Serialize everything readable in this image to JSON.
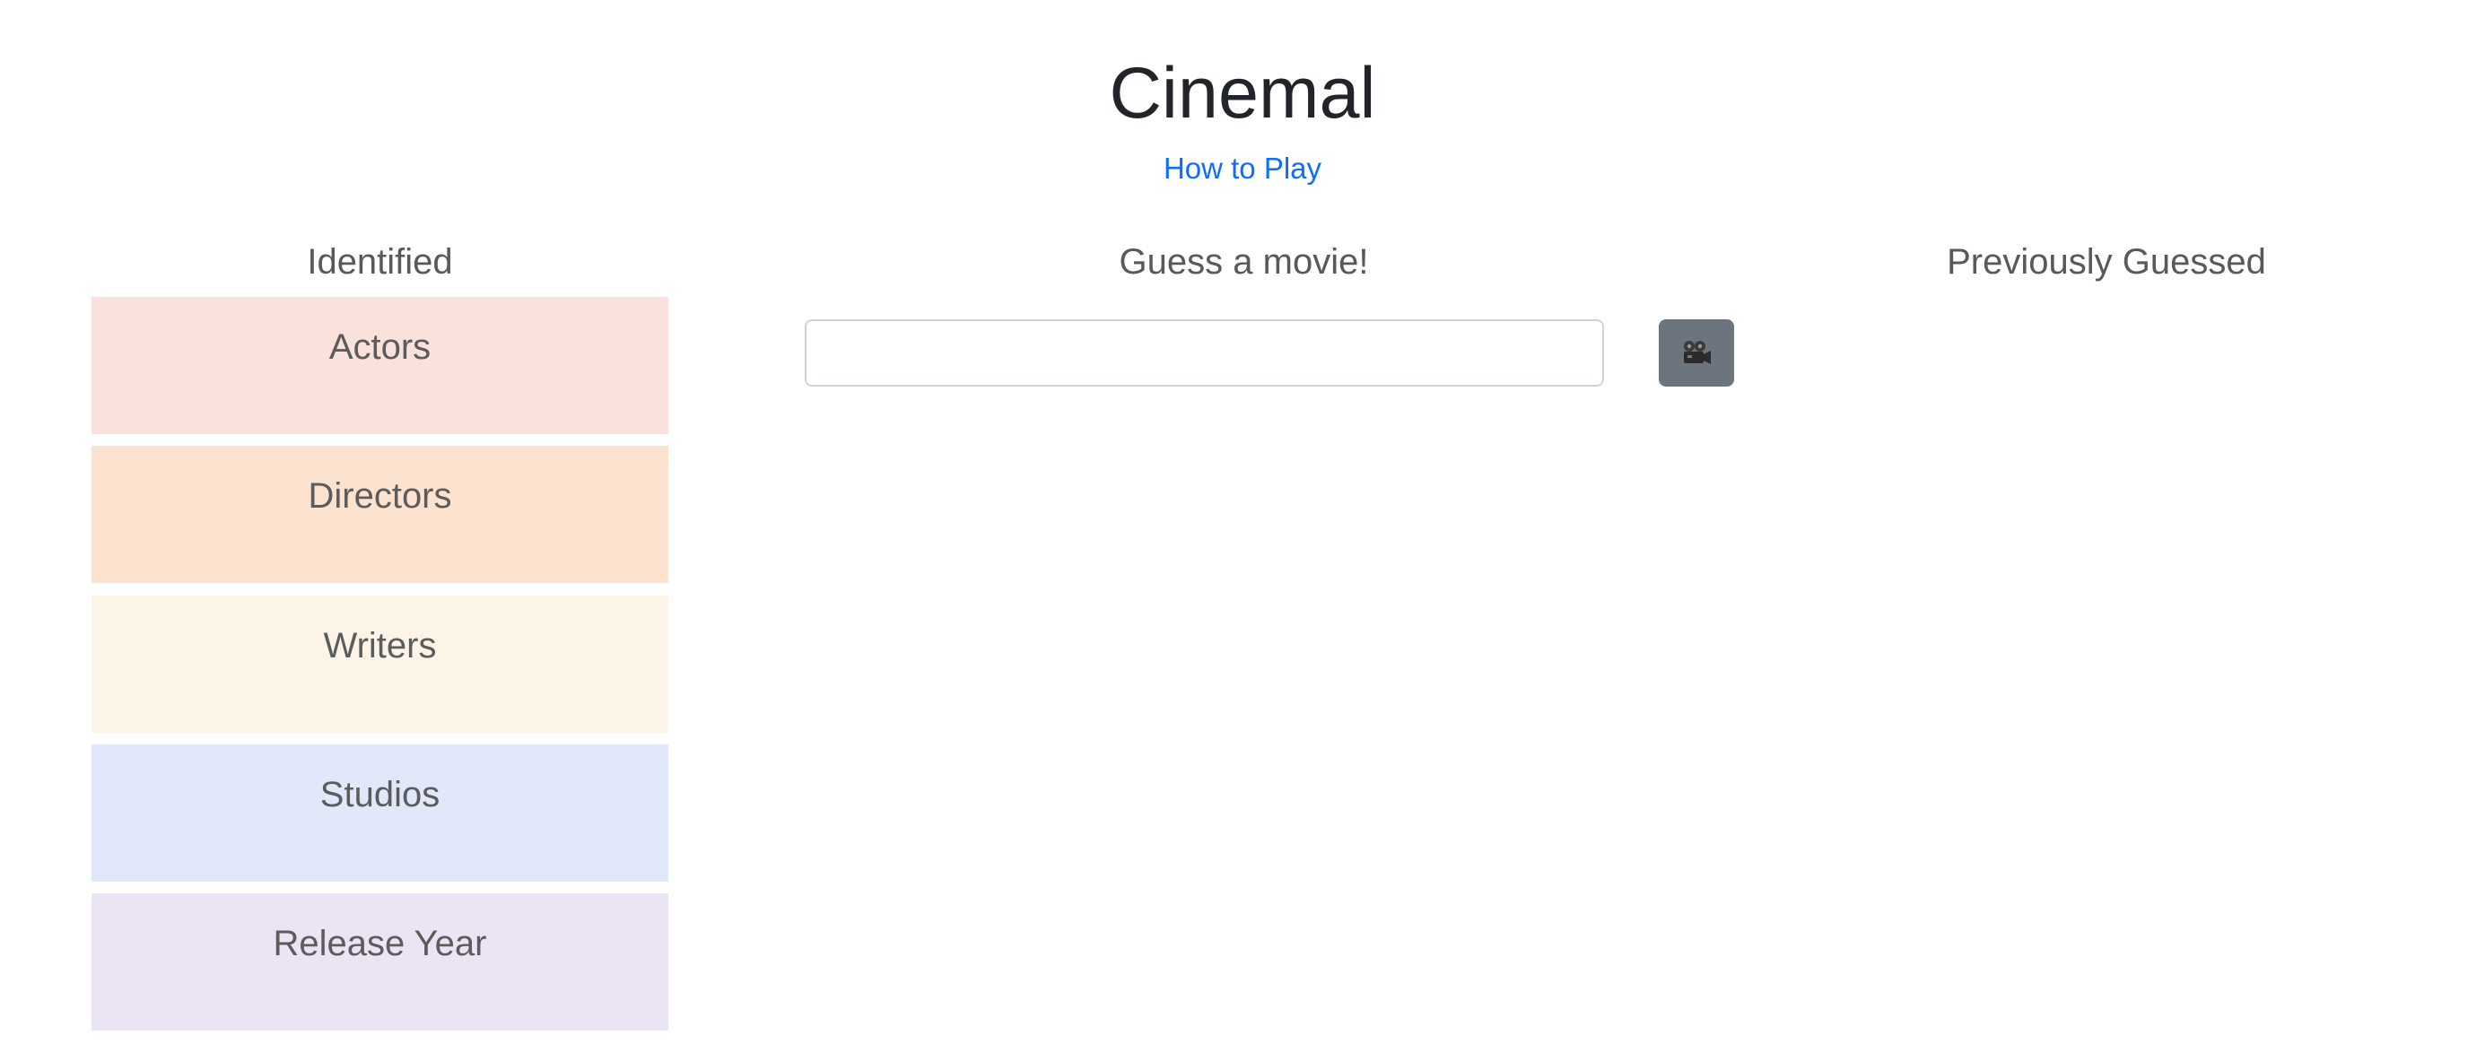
{
  "header": {
    "title": "Cinemal",
    "how_to_play_label": "How to Play"
  },
  "identified": {
    "heading": "Identified",
    "categories": [
      {
        "label": "Actors",
        "color": "#f9e1dc"
      },
      {
        "label": "Directors",
        "color": "#fbe3d0"
      },
      {
        "label": "Writers",
        "color": "#fcf5e7"
      },
      {
        "label": "Studios",
        "color": "#e1e8f9"
      },
      {
        "label": "Release Year",
        "color": "#ebe4f5"
      }
    ]
  },
  "guess": {
    "heading": "Guess a movie!",
    "input_value": "",
    "input_placeholder": "",
    "submit_icon": "movie-camera-icon"
  },
  "previous": {
    "heading": "Previously Guessed",
    "items": []
  },
  "colors": {
    "accent_link": "#0d6efd",
    "submit_button": "#6c757d"
  }
}
